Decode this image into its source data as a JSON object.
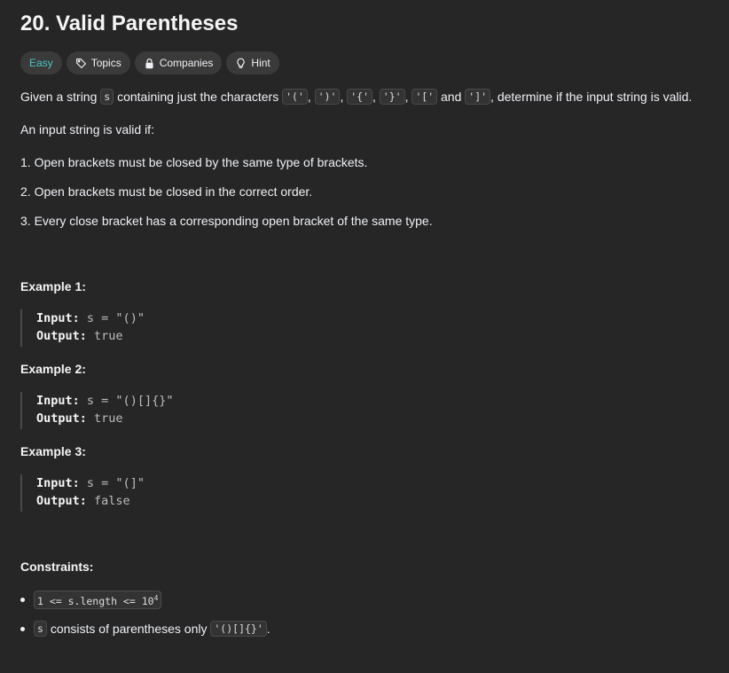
{
  "problem": {
    "title": "20. Valid Parentheses",
    "tags": {
      "difficulty": "Easy",
      "topics": "Topics",
      "companies": "Companies",
      "hint": "Hint"
    },
    "description": {
      "intro_start": "Given a string",
      "var_s": "s",
      "intro_middle": "containing just the characters",
      "chars": [
        "'('",
        "')'",
        "'{'",
        "'}'",
        "'['",
        "']'"
      ],
      "comma": ",",
      "and": "and",
      "intro_end": ", determine if the input string is valid.",
      "valid_if": "An input string is valid if:",
      "rules": [
        "1. Open brackets must be closed by the same type of brackets.",
        "2. Open brackets must be closed in the correct order.",
        "3. Every close bracket has a corresponding open bracket of the same type."
      ]
    },
    "examples": [
      {
        "heading": "Example 1:",
        "input_label": "Input:",
        "input": "s = \"()\"",
        "output_label": "Output:",
        "output": "true"
      },
      {
        "heading": "Example 2:",
        "input_label": "Input:",
        "input": "s = \"()[]{}\"",
        "output_label": "Output:",
        "output": "true"
      },
      {
        "heading": "Example 3:",
        "input_label": "Input:",
        "input": "s = \"(]\"",
        "output_label": "Output:",
        "output": "false"
      }
    ],
    "constraints": {
      "heading": "Constraints:",
      "c1_code": "1 <= s.length <= 10",
      "c1_sup": "4",
      "c2_var": "s",
      "c2_text": "consists of parentheses only",
      "c2_code": "'()[]{}'",
      "c2_end": "."
    }
  },
  "colors": {
    "background": "#262626",
    "easy": "#46c6c2",
    "tag_bg": "#3a3a3a"
  }
}
